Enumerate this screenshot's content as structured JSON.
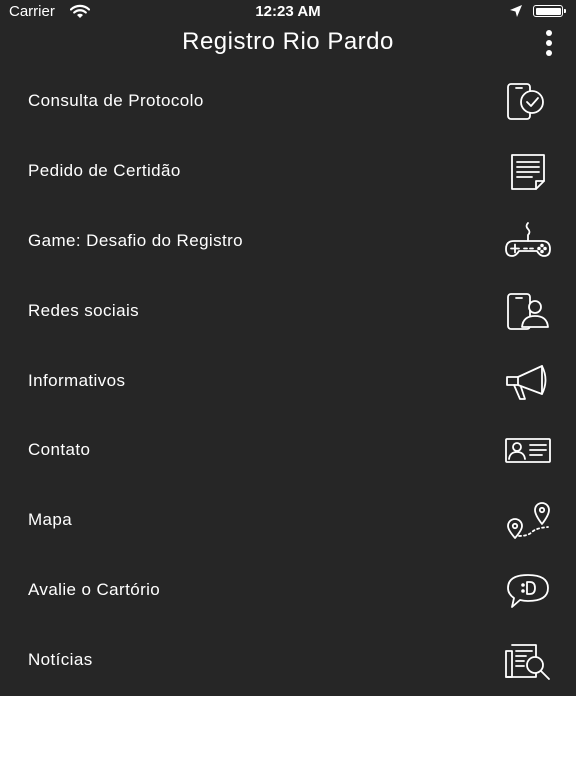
{
  "status_bar": {
    "carrier": "Carrier",
    "time": "12:23 AM"
  },
  "header": {
    "title": "Registro Rio Pardo",
    "more_icon": "more-vertical-icon"
  },
  "menu": {
    "items": [
      {
        "label": "Consulta de Protocolo",
        "icon": "phone-check-icon"
      },
      {
        "label": "Pedido de Certidão",
        "icon": "document-icon"
      },
      {
        "label": "Game: Desafio do Registro",
        "icon": "gamepad-icon"
      },
      {
        "label": "Redes sociais",
        "icon": "phone-user-icon"
      },
      {
        "label": "Informativos",
        "icon": "megaphone-icon"
      },
      {
        "label": "Contato",
        "icon": "contact-card-icon"
      },
      {
        "label": "Mapa",
        "icon": "map-route-icon"
      },
      {
        "label": "Avalie o Cartório",
        "icon": "chat-smile-icon"
      },
      {
        "label": "Notícias",
        "icon": "news-search-icon"
      }
    ]
  },
  "colors": {
    "background": "#262626",
    "text": "#ffffff",
    "below_content": "#ffffff"
  }
}
